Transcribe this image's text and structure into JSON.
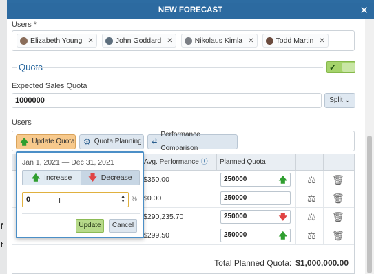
{
  "dialog": {
    "title": "NEW FORECAST",
    "close_icon": "close-icon"
  },
  "background": {
    "fragments": [
      "f",
      "f"
    ]
  },
  "users_field": {
    "label": "Users *",
    "chips": [
      {
        "name": "Elizabeth Young"
      },
      {
        "name": "John Goddard"
      },
      {
        "name": "Nikolaus Kimla"
      },
      {
        "name": "Todd Martin"
      }
    ],
    "remove_glyph": "✕"
  },
  "quota": {
    "section_title": "Quota",
    "toggle_on": true,
    "expected_label": "Expected Sales Quota",
    "expected_value": "1000000",
    "split_label": "Split"
  },
  "users_section": {
    "label": "Users"
  },
  "toolbar": {
    "update_quota": "Update Quota",
    "quota_planning": "Quota Planning",
    "performance_comparison": "Performance Comparison"
  },
  "table": {
    "columns": [
      "Avg. Performance",
      "Planned Quota"
    ],
    "rows": [
      {
        "avg": "$350.00",
        "quota": "250000",
        "trend": "up"
      },
      {
        "avg": "$0.00",
        "quota": "250000",
        "trend": "none"
      },
      {
        "avg": "$290,235.70",
        "quota": "250000",
        "trend": "down"
      },
      {
        "avg": "$299.50",
        "quota": "250000",
        "trend": "up"
      }
    ],
    "total_label": "Total Planned Quota:",
    "total_value": "$1,000,000.00"
  },
  "popover": {
    "date_range": "Jan 1, 2021 — Dec 31, 2021",
    "increase": "Increase",
    "decrease": "Decrease",
    "percent_value": "0",
    "percent_sign": "%",
    "update": "Update",
    "cancel": "Cancel"
  },
  "colors": {
    "title_bar": "#2c6aa0",
    "up_arrow": "#2f9e2f",
    "down_arrow": "#e04343",
    "toggle_green": "#a5d36b",
    "update_quota_btn": "#f7c98c"
  }
}
